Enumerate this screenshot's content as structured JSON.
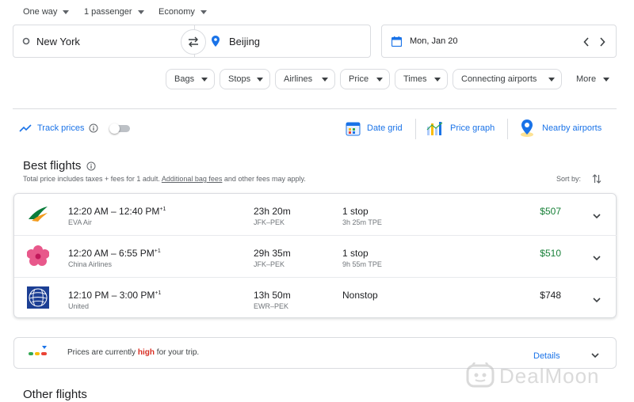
{
  "search": {
    "trip_type": "One way",
    "passengers": "1 passenger",
    "cabin": "Economy",
    "origin": "New York",
    "destination": "Beijing",
    "date": "Mon, Jan 20"
  },
  "filters": [
    "Bags",
    "Stops",
    "Airlines",
    "Price",
    "Times",
    "Connecting airports",
    "More"
  ],
  "tools": {
    "track_prices": "Track prices",
    "date_grid": "Date grid",
    "price_graph": "Price graph",
    "nearby_airports": "Nearby airports"
  },
  "best": {
    "title": "Best flights",
    "note_prefix": "Total price includes taxes + fees for 1 adult. ",
    "note_link": "Additional bag fees",
    "note_suffix": " and other fees may apply.",
    "sort_label": "Sort by:"
  },
  "flights": [
    {
      "times": "12:20 AM – 12:40 PM",
      "plus": "+1",
      "airline": "EVA Air",
      "duration": "23h 20m",
      "route": "JFK–PEK",
      "stops": "1 stop",
      "layover": "3h 25m TPE",
      "price": "$507"
    },
    {
      "times": "12:20 AM – 6:55 PM",
      "plus": "+1",
      "airline": "China Airlines",
      "duration": "29h 35m",
      "route": "JFK–PEK",
      "stops": "1 stop",
      "layover": "9h 55m TPE",
      "price": "$510"
    },
    {
      "times": "12:10 PM – 3:00 PM",
      "plus": "+1",
      "airline": "United",
      "duration": "13h 50m",
      "route": "EWR–PEK",
      "stops": "Nonstop",
      "layover": "",
      "price": "$748"
    }
  ],
  "insight": {
    "prefix": "Prices are currently ",
    "level": "high",
    "suffix": " for your trip.",
    "details": "Details"
  },
  "other": {
    "title": "Other flights"
  },
  "watermark": "DealMoon",
  "colors": {
    "accent": "#1a73e8",
    "good_price": "#188038",
    "high": "#d93025"
  }
}
